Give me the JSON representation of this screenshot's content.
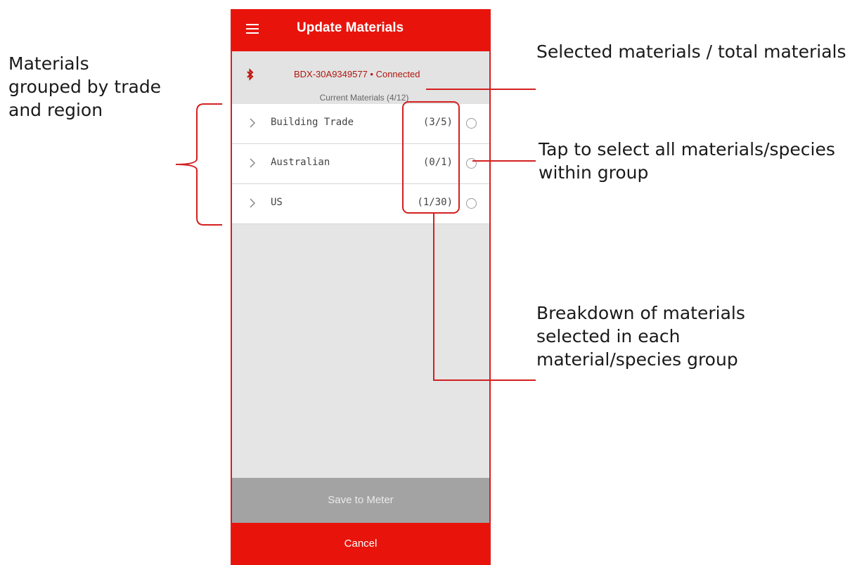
{
  "app": {
    "title": "Update Materials",
    "device_status": "BDX-30A9349577 • Connected",
    "current_materials": "Current Materials (4/12)"
  },
  "groups": [
    {
      "name": "Building Trade",
      "count": "(3/5)"
    },
    {
      "name": "Australian",
      "count": "(0/1)"
    },
    {
      "name": "US",
      "count": "(1/30)"
    }
  ],
  "buttons": {
    "save": "Save to Meter",
    "cancel": "Cancel"
  },
  "annotations": {
    "grouped": "Materials\ngrouped by trade\nand region",
    "selected_total": "Selected materials / total materials",
    "tap_select": "Tap to select all materials/species\nwithin group",
    "breakdown": "Breakdown of materials\nselected in each\nmaterial/species group"
  },
  "colors": {
    "accent": "#e8140c",
    "annotation_line": "#d42020",
    "device_text": "#b1160e",
    "save_button": "#a3a3a3"
  },
  "icons": [
    "menu-icon",
    "bluetooth-icon",
    "chevron-right-icon",
    "radio-icon"
  ]
}
